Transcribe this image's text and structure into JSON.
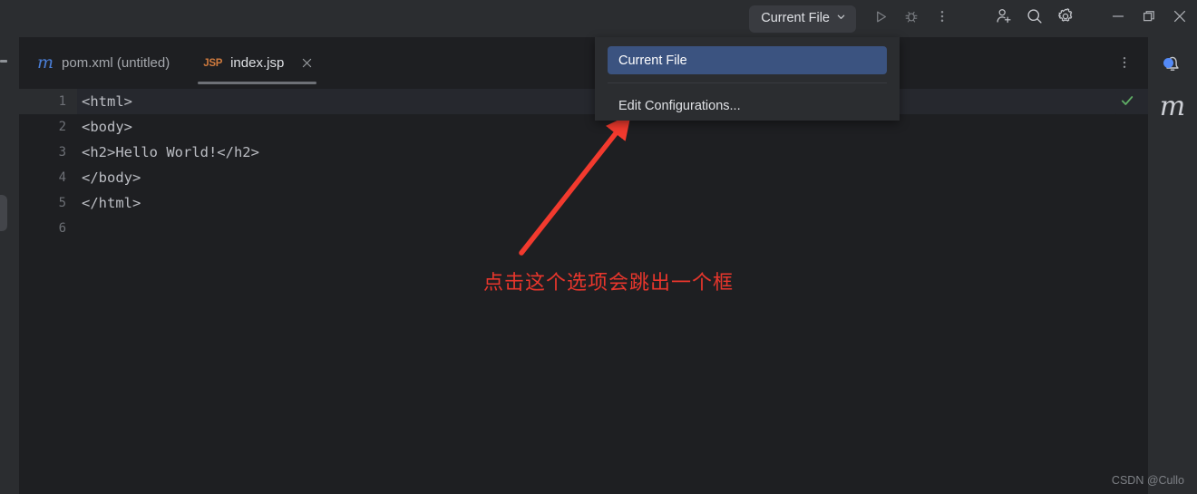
{
  "window": {
    "background_color": "#1e1f22",
    "titlebar_color": "#2b2d30",
    "accent_color": "#3b5380"
  },
  "titlebar": {
    "run_widget": {
      "label": "Current File",
      "chevron_icon": "chevron-down-icon"
    },
    "run_button": {
      "icon": "run-play-icon",
      "label": "Run"
    },
    "debug_button": {
      "icon": "debug-bug-icon",
      "label": "Debug"
    },
    "more_button": {
      "icon": "more-vertical-icon",
      "label": "More Actions"
    },
    "system_icons": [
      {
        "name": "add-user-icon",
        "label": "Code With Me"
      },
      {
        "name": "search-icon",
        "label": "Search Everywhere"
      },
      {
        "name": "gear-icon",
        "label": "Settings"
      }
    ],
    "window_controls": [
      {
        "name": "minimize-icon",
        "label": "Minimize"
      },
      {
        "name": "maximize-icon",
        "label": "Maximize"
      },
      {
        "name": "close-icon",
        "label": "Close"
      }
    ]
  },
  "run_dropdown": {
    "visible": true,
    "items": [
      {
        "label": "Current File",
        "selected": true
      },
      {
        "label": "Edit Configurations...",
        "selected": false
      }
    ]
  },
  "tabs": [
    {
      "label": "pom.xml (untitled)",
      "icon": "maven-file-icon",
      "icon_text": "m",
      "active": false,
      "closable": false
    },
    {
      "label": "index.jsp",
      "icon": "jsp-file-icon",
      "icon_text": "JSP",
      "active": true,
      "closable": true,
      "close_icon": "close-icon"
    }
  ],
  "tab_bar": {
    "more_icon": "more-vertical-icon"
  },
  "editor": {
    "inspection_status": {
      "icon": "checkmark-icon",
      "state": "ok",
      "color": "#5fad65"
    },
    "lines": [
      {
        "number": "1",
        "text": "<html>",
        "current": true
      },
      {
        "number": "2",
        "text": "<body>",
        "current": false
      },
      {
        "number": "3",
        "text": "<h2>Hello World!</h2>",
        "current": false
      },
      {
        "number": "4",
        "text": "</body>",
        "current": false
      },
      {
        "number": "5",
        "text": "</html>",
        "current": false
      },
      {
        "number": "6",
        "text": "",
        "current": false
      }
    ]
  },
  "right_sidebar": {
    "items": [
      {
        "name": "notifications-bell-icon",
        "label": "Notifications",
        "badge": true
      },
      {
        "name": "maven-tool-icon",
        "label": "Maven",
        "glyph": "m"
      }
    ]
  },
  "left_sidebar": {
    "handle": "tool-window-handle"
  },
  "annotation": {
    "text": "点击这个选项会跳出一个框",
    "color": "#e8362c",
    "arrow": "red-arrow-pointing-to-edit-configurations"
  },
  "watermark": {
    "text": "CSDN @Cullo"
  }
}
